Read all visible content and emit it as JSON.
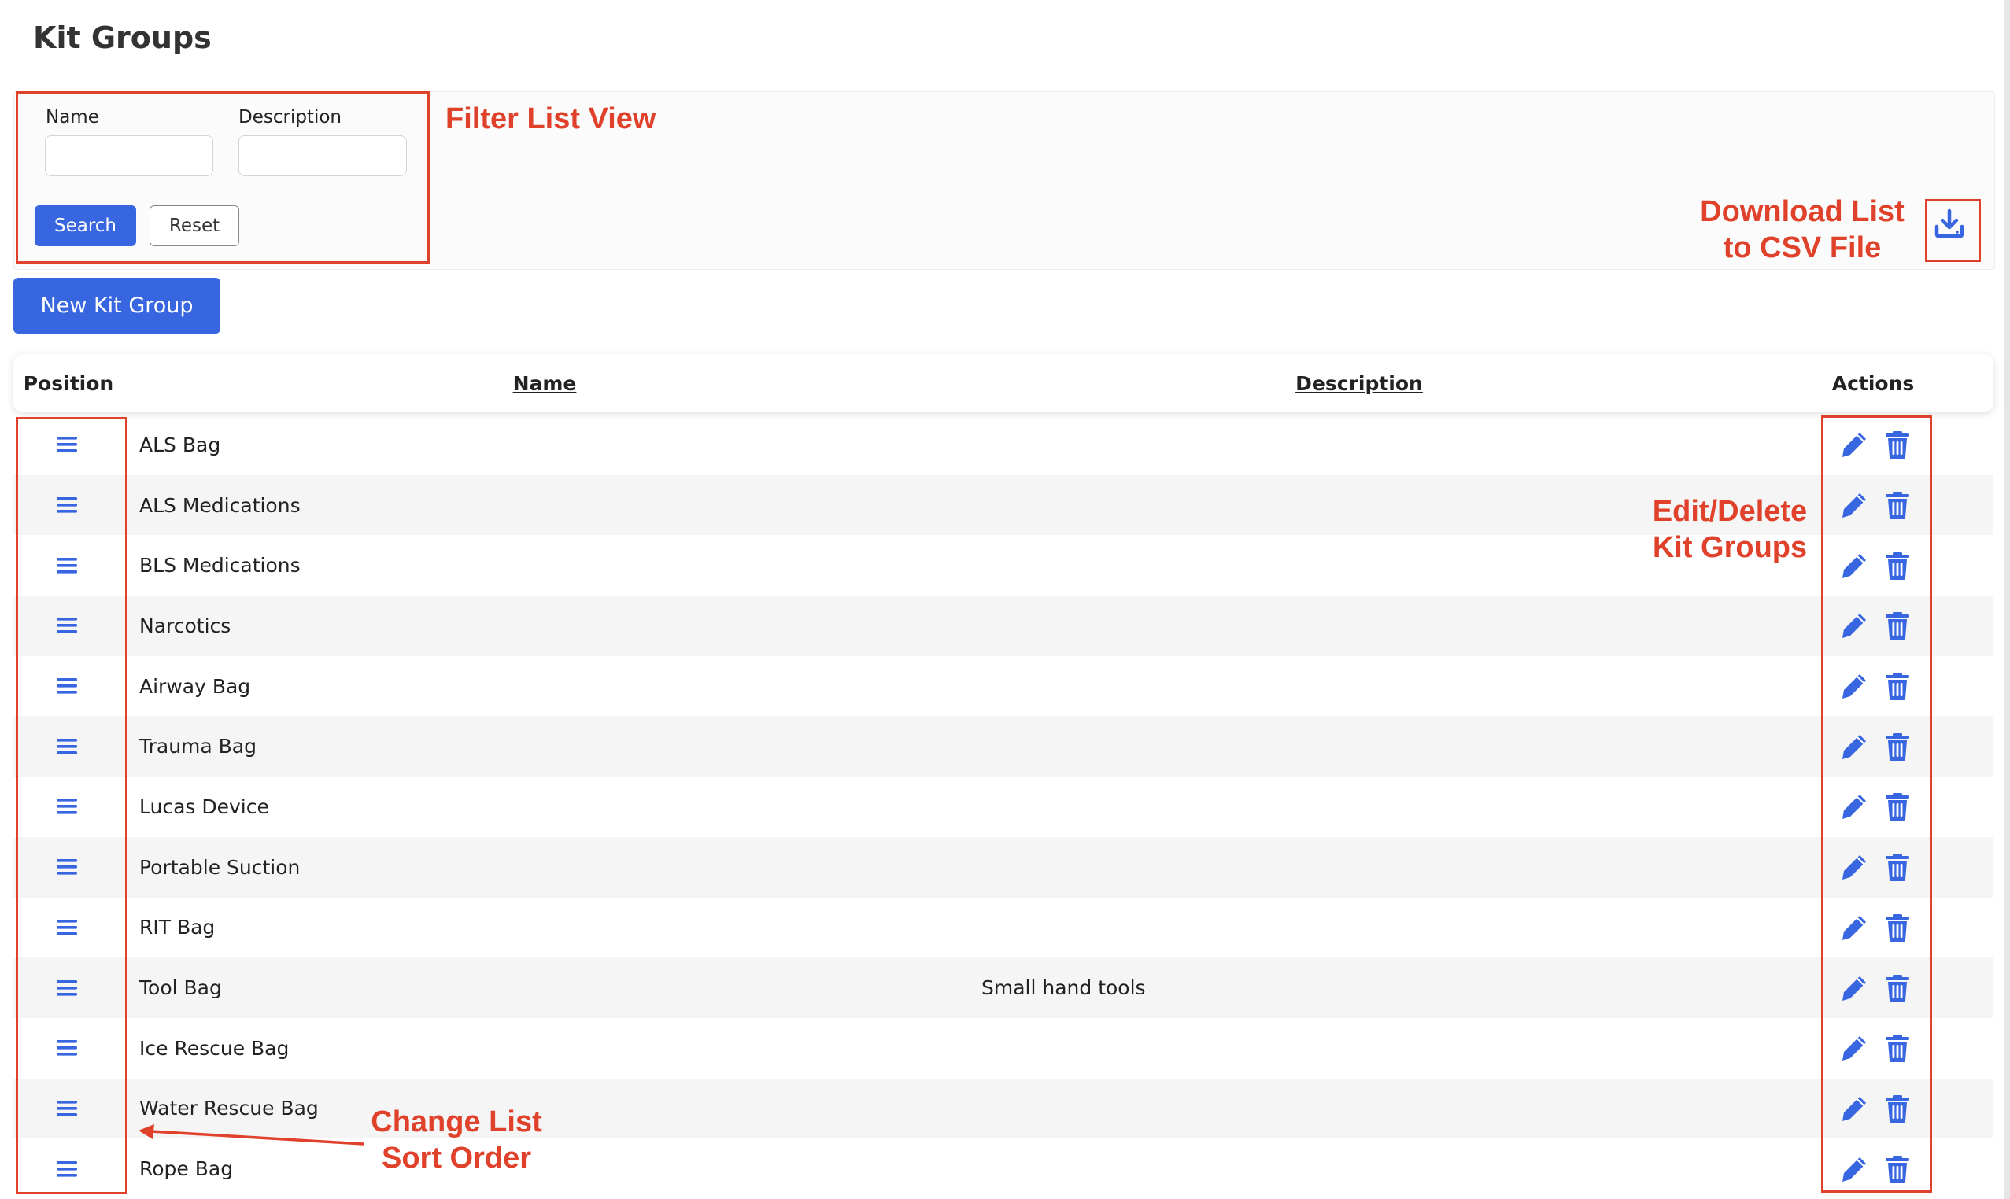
{
  "page": {
    "title": "Kit Groups"
  },
  "filters": {
    "name_label": "Name",
    "name_value": "",
    "description_label": "Description",
    "description_value": "",
    "search_label": "Search",
    "reset_label": "Reset"
  },
  "toolbar": {
    "new_label": "New Kit Group"
  },
  "table": {
    "headers": {
      "position": "Position",
      "name": "Name",
      "description": "Description",
      "actions": "Actions"
    },
    "rows": [
      {
        "name": "ALS Bag",
        "description": ""
      },
      {
        "name": "ALS Medications",
        "description": ""
      },
      {
        "name": "BLS Medications",
        "description": ""
      },
      {
        "name": "Narcotics",
        "description": ""
      },
      {
        "name": "Airway Bag",
        "description": ""
      },
      {
        "name": "Trauma Bag",
        "description": ""
      },
      {
        "name": "Lucas Device",
        "description": ""
      },
      {
        "name": "Portable Suction",
        "description": ""
      },
      {
        "name": "RIT Bag",
        "description": ""
      },
      {
        "name": "Tool Bag",
        "description": "Small hand tools"
      },
      {
        "name": "Ice Rescue Bag",
        "description": ""
      },
      {
        "name": "Water Rescue Bag",
        "description": ""
      },
      {
        "name": "Rope Bag",
        "description": ""
      }
    ]
  },
  "annotations": {
    "filter": "Filter List View",
    "download_line1": "Download List",
    "download_line2": "to CSV File",
    "edit_line1": "Edit/Delete",
    "edit_line2": "Kit Groups",
    "sort_line1": "Change List",
    "sort_line2": "Sort Order"
  },
  "icons": {
    "drag": "drag-handle-icon",
    "edit": "pencil-icon",
    "delete": "trash-icon",
    "download": "download-icon"
  },
  "colors": {
    "primary": "#3865e0",
    "annotation": "#e0412b",
    "row_alt": "#f5f5f5"
  }
}
